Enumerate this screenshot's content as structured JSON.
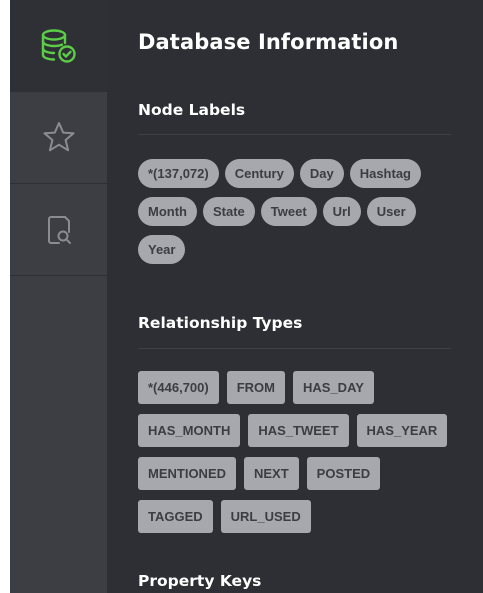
{
  "rail": {
    "items": [
      {
        "icon": "database-check-icon",
        "active": true
      },
      {
        "icon": "star-icon",
        "active": false
      },
      {
        "icon": "document-search-icon",
        "active": false
      }
    ],
    "accent": "#5ccd47"
  },
  "panel": {
    "title": "Database Information",
    "node_labels": {
      "title": "Node Labels",
      "items": [
        "*(137,072)",
        "Century",
        "Day",
        "Hashtag",
        "Month",
        "State",
        "Tweet",
        "Url",
        "User",
        "Year"
      ]
    },
    "relationship_types": {
      "title": "Relationship Types",
      "items": [
        "*(446,700)",
        "FROM",
        "HAS_DAY",
        "HAS_MONTH",
        "HAS_TWEET",
        "HAS_YEAR",
        "MENTIONED",
        "NEXT",
        "POSTED",
        "TAGGED",
        "URL_USED"
      ]
    },
    "property_keys": {
      "title": "Property Keys"
    }
  }
}
